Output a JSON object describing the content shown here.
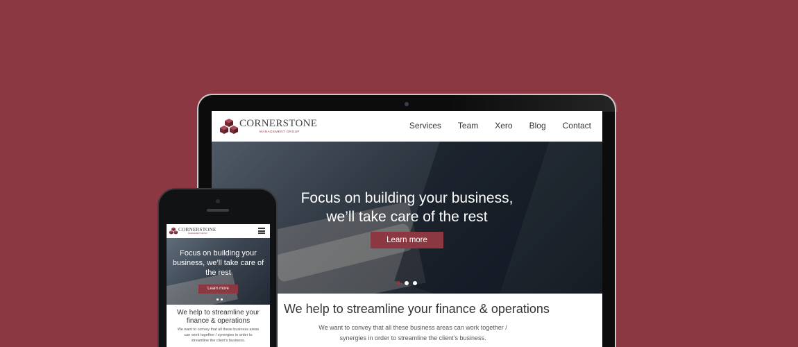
{
  "brand": {
    "name": "CORNERSTONE",
    "tagline": "MANAGEMENT GROUP",
    "colors": {
      "accent": "#8c3843",
      "background": "#8c3843",
      "text": "#333333"
    }
  },
  "desktop": {
    "nav": {
      "items": [
        {
          "label": "Services"
        },
        {
          "label": "Team"
        },
        {
          "label": "Xero"
        },
        {
          "label": "Blog"
        },
        {
          "label": "Contact"
        }
      ]
    },
    "hero": {
      "title_line1": "Focus on building your business,",
      "title_line2": "we’ll take care of the rest",
      "button_label": "Learn more",
      "slides": {
        "count": 3,
        "active": 1
      }
    },
    "content": {
      "heading": "We help to streamline your finance & operations",
      "body": "We want to convey that all these business areas can work together / synergies in order to streamline the client’s business."
    }
  },
  "mobile": {
    "nav": {
      "menu_icon": "hamburger-icon"
    },
    "hero": {
      "title": "Focus on building your business, we’ll take care of the rest",
      "button_label": "Learn more",
      "slides": {
        "count": 2,
        "active": 1
      }
    },
    "content": {
      "heading": "We help to streamline your finance & operations",
      "body": "We want to convey that all these business areas can work together / synergies in order to streamline the client’s business."
    }
  }
}
